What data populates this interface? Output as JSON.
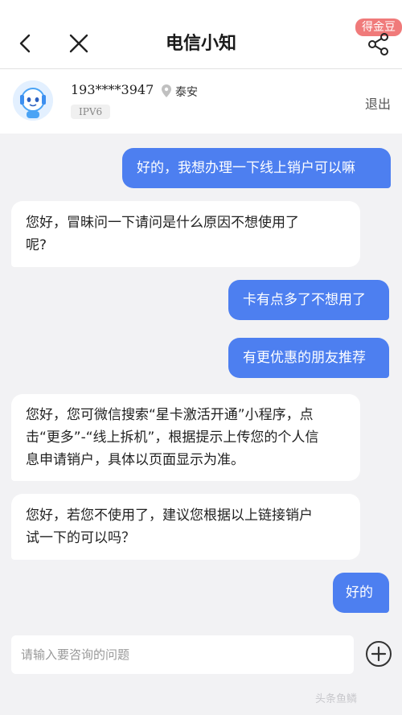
{
  "nav": {
    "title": "电信小知",
    "badge": "得金豆"
  },
  "user": {
    "phone": "193****3947",
    "location": "泰安",
    "network": "IPV6",
    "logout": "退出"
  },
  "messages": [
    {
      "from": "user",
      "text": "好的，我想办理一下线上销户可以嘛"
    },
    {
      "from": "bot",
      "lines": [
        "您好，冒昧问一下请问是什么原因不想使用了",
        "呢?"
      ]
    },
    {
      "from": "user",
      "text": "卡有点多了不想用了"
    },
    {
      "from": "user",
      "text": "有更优惠的朋友推荐"
    },
    {
      "from": "bot",
      "lines": [
        "您好，您可微信搜索“星卡激活开通”小程序，点",
        "击“更多”-“线上拆机”，根据提示上传您的个人信",
        "息申请销户，具体以页面显示为准。"
      ]
    },
    {
      "from": "bot",
      "lines": [
        "您好，若您不使用了，建议您根据以上链接销户",
        "试一下的可以吗？"
      ]
    },
    {
      "from": "user",
      "text": "好的"
    }
  ],
  "input": {
    "placeholder": "请输入要咨询的问题"
  },
  "watermark": "头条鱼鳞",
  "icons": [
    "back-icon",
    "close-icon",
    "share-icon",
    "location-icon",
    "avatar-robot",
    "plus-icon"
  ],
  "colors": {
    "accent": "#4d7ff0",
    "badge": "#f07a7a"
  }
}
